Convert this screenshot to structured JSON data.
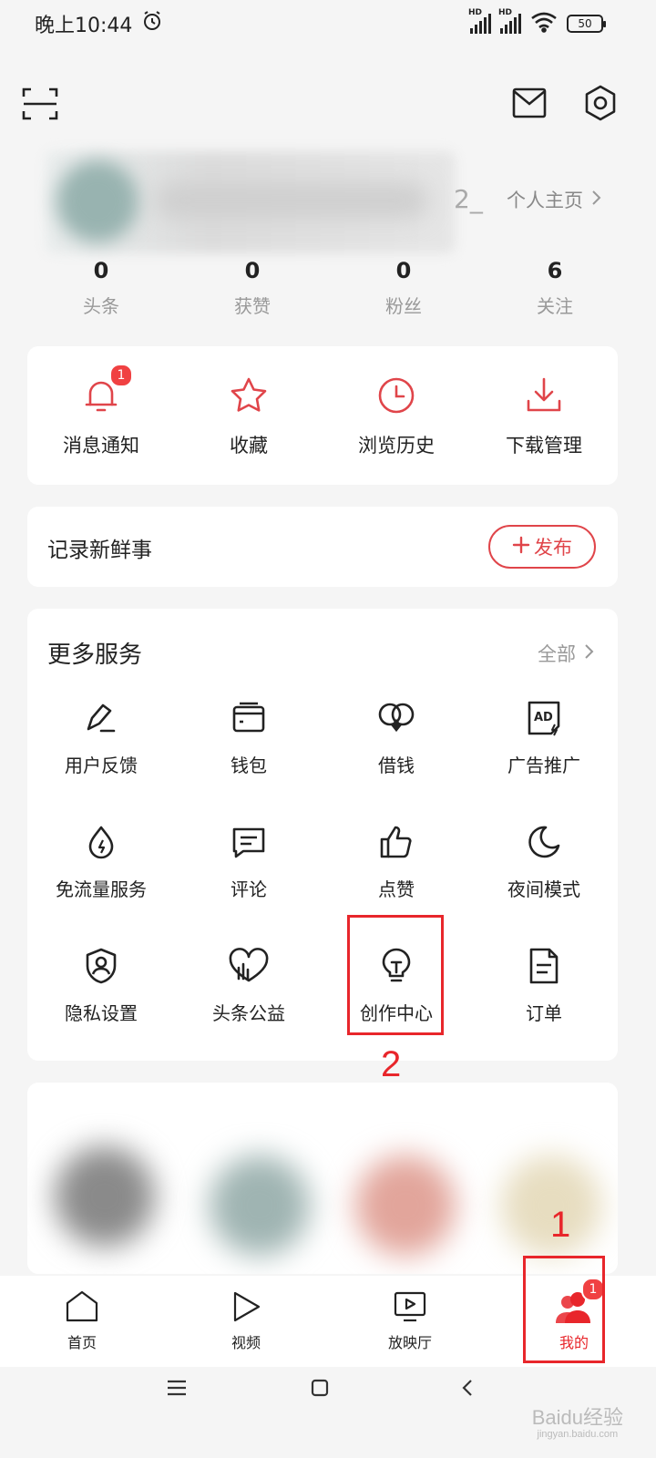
{
  "status_bar": {
    "time": "晚上10:44",
    "signal_label_1": "HD",
    "signal_label_2": "HD",
    "battery": "50"
  },
  "profile": {
    "partial_text": "2_",
    "homepage_link": "个人主页"
  },
  "stats": [
    {
      "value": "0",
      "label": "头条"
    },
    {
      "value": "0",
      "label": "获赞"
    },
    {
      "value": "0",
      "label": "粉丝"
    },
    {
      "value": "6",
      "label": "关注"
    }
  ],
  "quick_actions": [
    {
      "label": "消息通知",
      "icon": "bell-icon",
      "badge": "1"
    },
    {
      "label": "收藏",
      "icon": "star-icon"
    },
    {
      "label": "浏览历史",
      "icon": "clock-icon"
    },
    {
      "label": "下载管理",
      "icon": "download-icon"
    }
  ],
  "record": {
    "title": "记录新鲜事",
    "publish_label": "发布"
  },
  "services": {
    "title": "更多服务",
    "all_label": "全部",
    "items": [
      {
        "label": "用户反馈",
        "icon": "pen-icon"
      },
      {
        "label": "钱包",
        "icon": "wallet-icon"
      },
      {
        "label": "借钱",
        "icon": "loan-icon"
      },
      {
        "label": "广告推广",
        "icon": "ad-icon"
      },
      {
        "label": "免流量服务",
        "icon": "data-drop-icon"
      },
      {
        "label": "评论",
        "icon": "comment-icon"
      },
      {
        "label": "点赞",
        "icon": "thumbs-up-icon"
      },
      {
        "label": "夜间模式",
        "icon": "moon-icon"
      },
      {
        "label": "隐私设置",
        "icon": "shield-user-icon"
      },
      {
        "label": "头条公益",
        "icon": "charity-icon"
      },
      {
        "label": "创作中心",
        "icon": "lightbulb-icon"
      },
      {
        "label": "订单",
        "icon": "document-icon"
      }
    ]
  },
  "annotations": {
    "step1": "1",
    "step2": "2"
  },
  "tabbar": {
    "tabs": [
      {
        "label": "首页",
        "icon": "home-icon"
      },
      {
        "label": "视频",
        "icon": "play-icon"
      },
      {
        "label": "放映厅",
        "icon": "tv-play-icon"
      },
      {
        "label": "我的",
        "icon": "user-group-icon",
        "badge": "1",
        "active": true
      }
    ]
  },
  "watermark": {
    "text": "Baidu经验",
    "sub": "jingyan.baidu.com"
  },
  "colors": {
    "accent": "#e8262b",
    "quick_icon": "#e0454a"
  }
}
